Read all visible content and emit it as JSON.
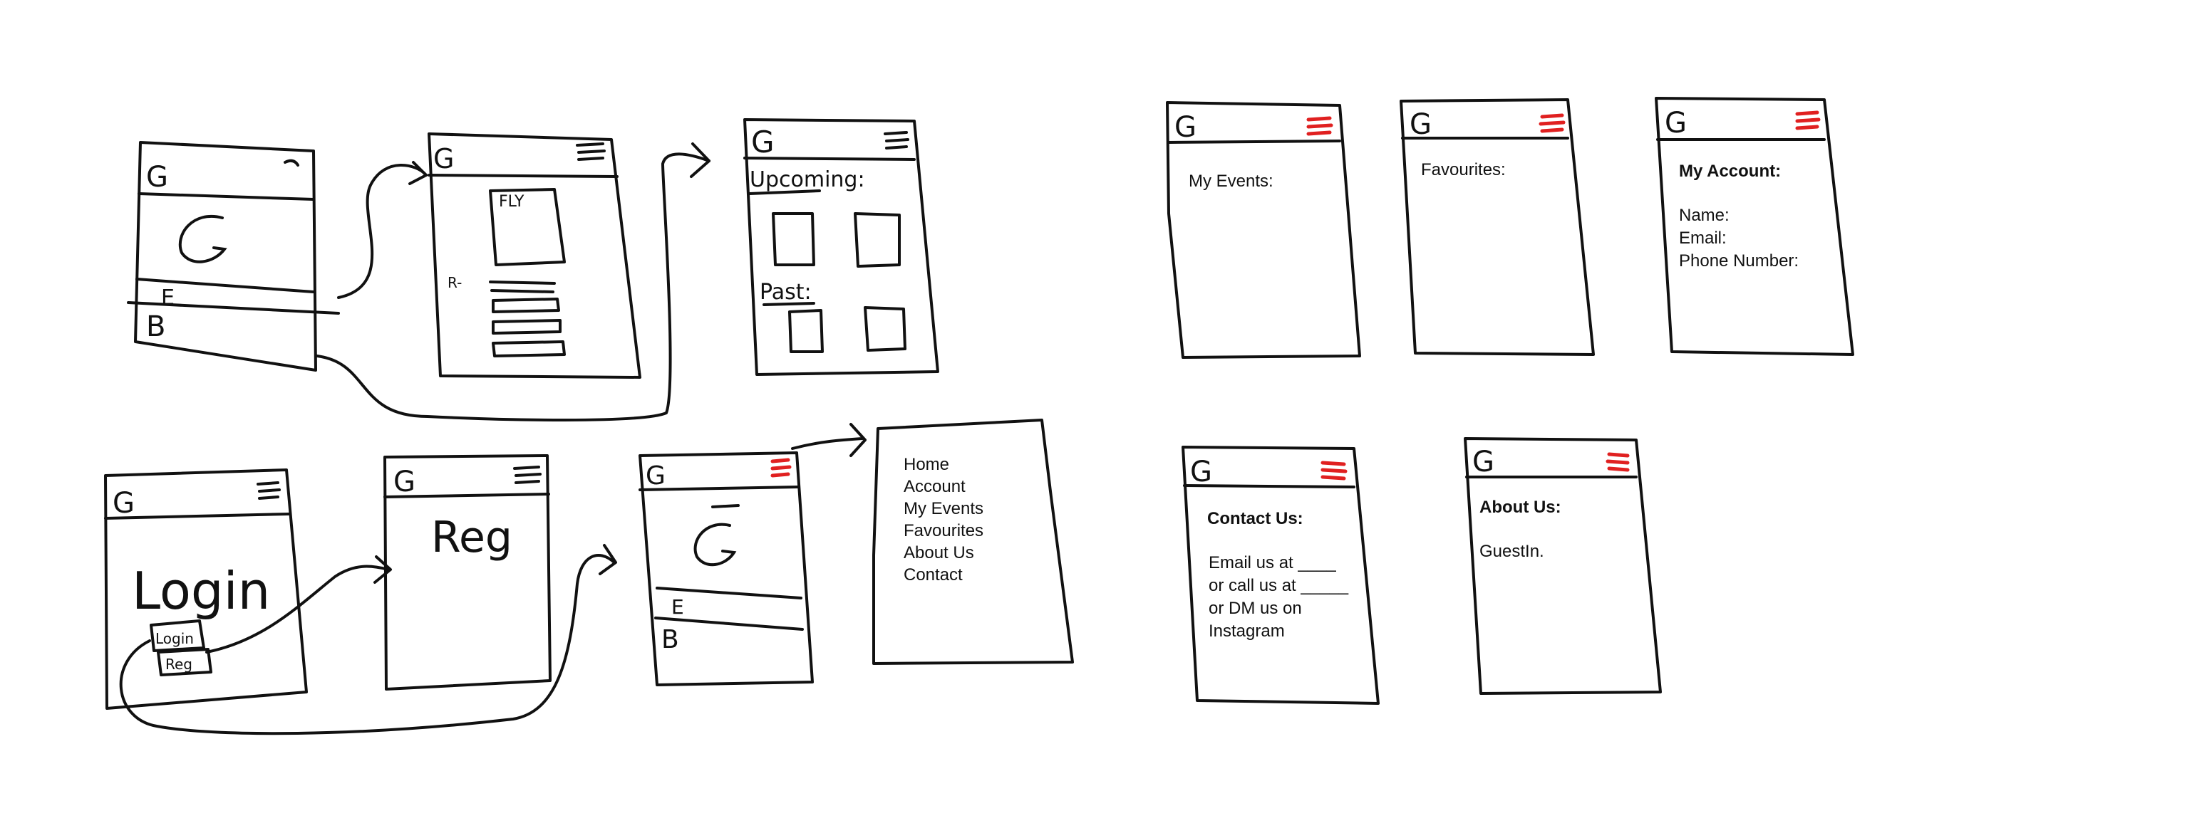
{
  "colors": {
    "ink": "#111111",
    "accent": "#e02020",
    "paper": "#ffffff"
  },
  "icons": {
    "logo": "letter-g-logo",
    "menu": "hamburger-menu-icon"
  },
  "sketch": {
    "logo_letter": "G",
    "home": {
      "events_letter": "E",
      "bookings_letter": "B",
      "menu_mark": "e"
    },
    "events": {
      "flyer_label": "FLY",
      "list_label": "R-"
    },
    "upcoming": {
      "upcoming_title": "Upcoming:",
      "past_title": "Past:"
    },
    "login": {
      "title": "Login",
      "login_button": "Login",
      "reg_button": "Reg"
    },
    "register": {
      "title": "Reg"
    },
    "menu_home": {
      "events_letter": "E",
      "bookings_letter": "B"
    },
    "nav_menu": {
      "items": [
        "Home",
        "Account",
        "My Events",
        "Favourites",
        "About Us",
        "Contact"
      ]
    },
    "my_events": {
      "title": "My Events:"
    },
    "favourites": {
      "title": "Favourites:"
    },
    "account": {
      "title": "My Account:",
      "fields": [
        "Name:",
        "Email:",
        "Phone Number:"
      ]
    },
    "contact": {
      "title": "Contact Us:",
      "lines": [
        "Email us at ____",
        "or call us at _____",
        "or DM us on",
        "Instagram"
      ]
    },
    "about": {
      "title": "About Us:",
      "text": "GuestIn."
    }
  }
}
